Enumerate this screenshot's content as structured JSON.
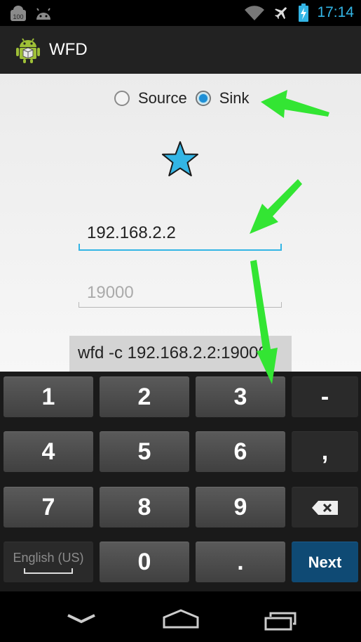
{
  "status_bar": {
    "battery_badge": "100",
    "clock": "17:14"
  },
  "app": {
    "title": "WFD"
  },
  "mode": {
    "options": [
      "Source",
      "Sink"
    ],
    "selected": "Sink"
  },
  "ip_field": {
    "value": "192.168.2.2"
  },
  "port_field": {
    "placeholder": "19000"
  },
  "command_button": {
    "label": "wfd -c 192.168.2.2:19000"
  },
  "keyboard": {
    "rows": [
      [
        "1",
        "2",
        "3",
        "-"
      ],
      [
        "4",
        "5",
        "6",
        ","
      ],
      [
        "7",
        "8",
        "9",
        "⌫"
      ],
      [
        "English (US)",
        "0",
        ".",
        "Next"
      ]
    ]
  },
  "colors": {
    "accent": "#33b5e5",
    "next_key": "#0f4a74",
    "arrow": "#33e533"
  }
}
